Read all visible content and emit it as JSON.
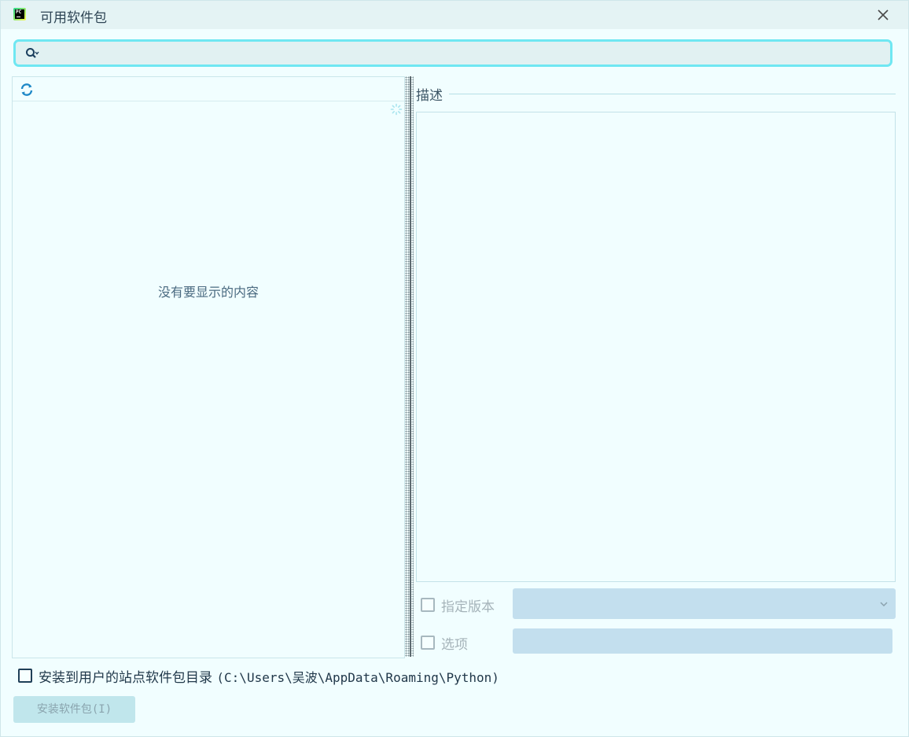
{
  "window": {
    "title": "可用软件包"
  },
  "search": {
    "value": "",
    "placeholder": ""
  },
  "package_list": {
    "empty_text": "没有要显示的内容"
  },
  "description": {
    "label": "描述"
  },
  "options": {
    "specify_version_label": "指定版本",
    "specify_version_checked": false,
    "options_label": "选项",
    "options_checked": false,
    "options_value": ""
  },
  "install_to_user": {
    "label": "安装到用户的站点软件包目录",
    "path": "(C:\\Users\\吴波\\AppData\\Roaming\\Python)",
    "checked": false
  },
  "install_button": {
    "label": "安装软件包(I)"
  },
  "colors": {
    "accent": "#6fe7f2",
    "background": "#f1feff",
    "field_disabled": "#c3dfee",
    "button_disabled": "#c0e6ec"
  },
  "icons": {
    "app": "pycharm-icon",
    "close": "close-icon",
    "search": "search-icon",
    "refresh": "refresh-icon",
    "loading": "spinner-icon",
    "dropdown": "chevron-down-icon"
  }
}
